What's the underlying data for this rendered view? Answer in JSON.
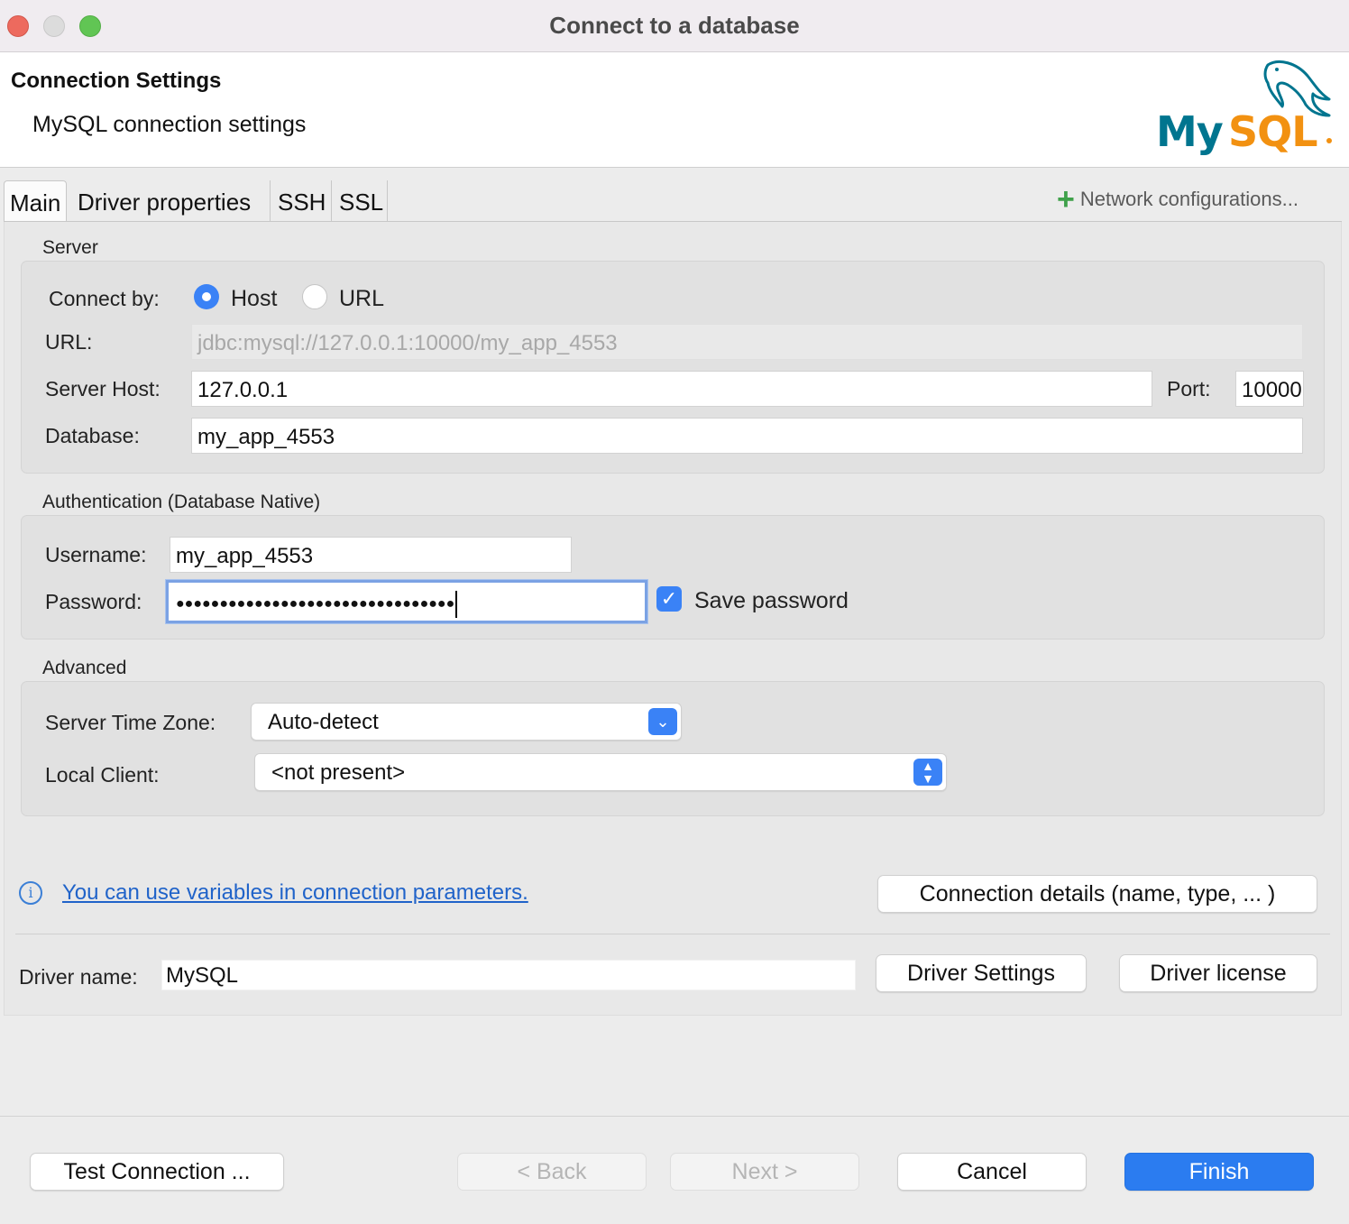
{
  "window": {
    "title": "Connect to a database"
  },
  "header": {
    "title": "Connection Settings",
    "subtitle": "MySQL connection settings",
    "logo_text": "MySQL"
  },
  "tabs": [
    {
      "label": "Main",
      "active": true
    },
    {
      "label": "Driver properties",
      "active": false
    },
    {
      "label": "SSH",
      "active": false
    },
    {
      "label": "SSL",
      "active": false
    }
  ],
  "network_config": {
    "icon": "plus-icon",
    "label": "Network configurations..."
  },
  "server": {
    "group_label": "Server",
    "connect_by_label": "Connect by:",
    "host_option": "Host",
    "url_option": "URL",
    "selected": "Host",
    "url_label": "URL:",
    "url_value": "jdbc:mysql://127.0.0.1:10000/my_app_4553",
    "host_label": "Server Host:",
    "host_value": "127.0.0.1",
    "port_label": "Port:",
    "port_value": "10000",
    "database_label": "Database:",
    "database_value": "my_app_4553"
  },
  "auth": {
    "group_label": "Authentication (Database Native)",
    "username_label": "Username:",
    "username_value": "my_app_4553",
    "password_label": "Password:",
    "password_masked": "●●●●●●●●●●●●●●●●●●●●●●●●●●●●●●●●",
    "save_password_label": "Save password",
    "save_password_checked": true
  },
  "advanced": {
    "group_label": "Advanced",
    "timezone_label": "Server Time Zone:",
    "timezone_value": "Auto-detect",
    "local_client_label": "Local Client:",
    "local_client_value": "<not present>"
  },
  "info": {
    "icon": "info-icon",
    "link_text": "You can use variables in connection parameters."
  },
  "connection_details_button": "Connection details (name, type, ... )",
  "driver": {
    "name_label": "Driver name:",
    "name_value": "MySQL",
    "settings_button": "Driver Settings",
    "license_button": "Driver license"
  },
  "footer": {
    "test_button": "Test Connection ...",
    "back_button": "< Back",
    "next_button": "Next >",
    "cancel_button": "Cancel",
    "finish_button": "Finish"
  },
  "colors": {
    "accent": "#2b7cf0",
    "link": "#2063c9",
    "mysql_blue": "#00758f",
    "mysql_orange": "#f29111"
  }
}
